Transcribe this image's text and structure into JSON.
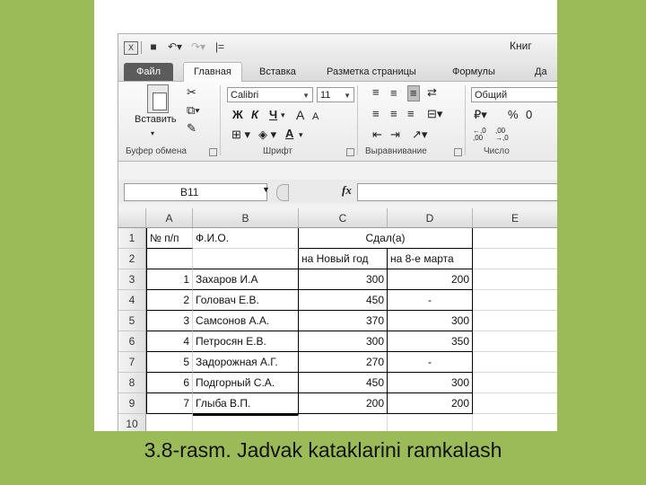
{
  "window": {
    "title_partial": "Книг"
  },
  "quick_access": {
    "save_icon": "save-icon",
    "undo_icon": "undo-icon",
    "redo_icon": "redo-icon",
    "customize": "|="
  },
  "tabs": [
    "Файл",
    "Главная",
    "Вставка",
    "Разметка страницы",
    "Формулы",
    "Да"
  ],
  "ribbon": {
    "clipboard": {
      "paste_label": "Вставить",
      "group_label": "Буфер обмена"
    },
    "font": {
      "font_name": "Calibri",
      "font_size": "11",
      "bold": "Ж",
      "italic": "К",
      "underline": "Ч",
      "grow": "A",
      "shrink": "A",
      "font_color": "A",
      "group_label": "Шрифт"
    },
    "alignment": {
      "group_label": "Выравнивание"
    },
    "number": {
      "format": "Общий",
      "percent": "%",
      "thousands": "0",
      "inc_decimal": "←,0 ,00",
      "dec_decimal": ",00 →,0",
      "group_label": "Число"
    }
  },
  "formula_bar": {
    "name_box": "B11",
    "fx": "fx",
    "formula": ""
  },
  "sheet": {
    "columns": [
      "A",
      "B",
      "C",
      "D",
      "E"
    ],
    "rows": [
      {
        "n": "1",
        "a": "№ п/п",
        "b": "Ф.И.О.",
        "cd": "Сдал(а)",
        "e": ""
      },
      {
        "n": "2",
        "a": "",
        "b": "",
        "c": "на Новый год",
        "d": "на 8-е марта",
        "e": ""
      },
      {
        "n": "3",
        "a": "1",
        "b": "Захаров И.А",
        "c": "300",
        "d": "200",
        "e": ""
      },
      {
        "n": "4",
        "a": "2",
        "b": "Головач Е.В.",
        "c": "450",
        "d": "-",
        "e": ""
      },
      {
        "n": "5",
        "a": "3",
        "b": "Самсонов А.А.",
        "c": "370",
        "d": "300",
        "e": ""
      },
      {
        "n": "6",
        "a": "4",
        "b": "Петросян Е.В.",
        "c": "300",
        "d": "350",
        "e": ""
      },
      {
        "n": "7",
        "a": "5",
        "b": "Задорожная А.Г.",
        "c": "270",
        "d": "-",
        "e": ""
      },
      {
        "n": "8",
        "a": "6",
        "b": "Подгорный С.А.",
        "c": "450",
        "d": "300",
        "e": ""
      },
      {
        "n": "9",
        "a": "7",
        "b": "Глыба В.П.",
        "c": "200",
        "d": "200",
        "e": ""
      },
      {
        "n": "10",
        "a": "",
        "b": "",
        "c": "",
        "d": "",
        "e": ""
      }
    ]
  },
  "caption": "3.8-rasm. Jadvak kataklarini ramkalash"
}
